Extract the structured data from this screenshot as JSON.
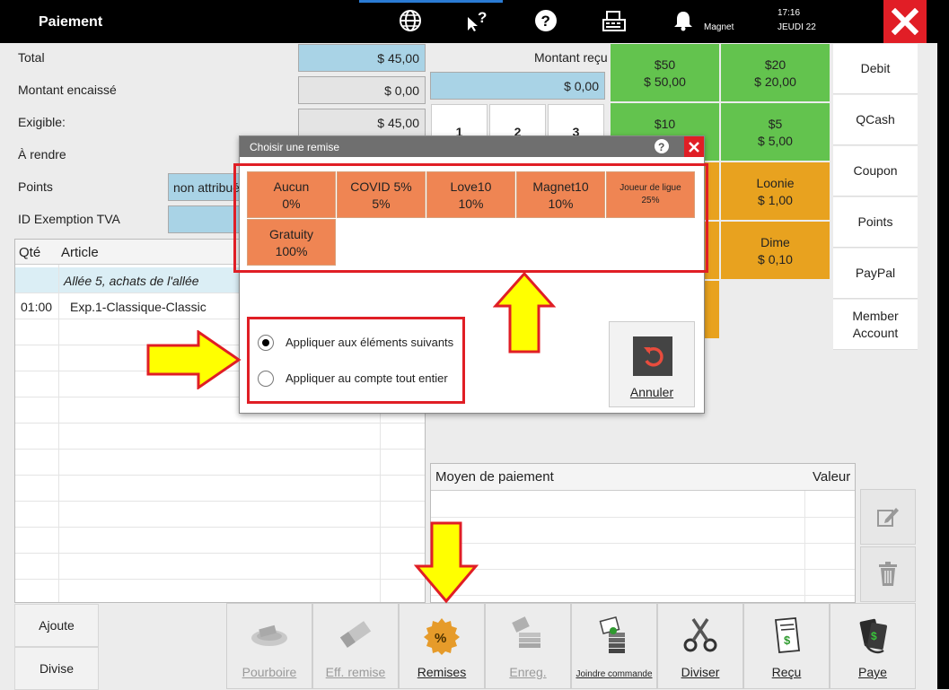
{
  "topbar": {
    "title": "Paiement",
    "user": "Magnet",
    "time": "17:16",
    "day": "JEUDI 22",
    "icons": [
      "globe-icon",
      "help-cursor-icon",
      "help-icon",
      "cash-register-icon",
      "bell-icon",
      "close-icon"
    ]
  },
  "summary": {
    "total_label": "Total",
    "total_value": "$ 45,00",
    "encaisse_label": "Montant encaissé",
    "encaisse_value": "$ 0,00",
    "exigible_label": "Exigible:",
    "exigible_value": "$ 45,00",
    "rendre_label": "À rendre",
    "points_label": "Points",
    "points_value": "non attribué",
    "tva_label": "ID Exemption TVA"
  },
  "items_table": {
    "headers": {
      "qty": "Qté",
      "article": "Article"
    },
    "group": "Allée 5, achats de l'allée",
    "rows": [
      {
        "qty": "01:00",
        "article": "Exp.1-Classique-Classic"
      }
    ]
  },
  "payment": {
    "received_label": "Montant reçu",
    "received_value": "$ 0,00",
    "keypad": [
      "1",
      "2",
      "3"
    ],
    "cash": [
      {
        "label": "$50",
        "value": "$ 50,00",
        "color": "#63c34e"
      },
      {
        "label": "$20",
        "value": "$ 20,00",
        "color": "#63c34e"
      },
      {
        "label": "$10",
        "value": "",
        "color": "#63c34e"
      },
      {
        "label": "$5",
        "value": "$ 5,00",
        "color": "#63c34e"
      },
      {
        "label": "Loonie",
        "value": "$ 1,00",
        "color": "#e8a21f"
      },
      {
        "label": "Dime",
        "value": "$ 0,10",
        "color": "#e8a21f"
      }
    ],
    "methods": [
      "Debit",
      "QCash",
      "Coupon",
      "Points",
      "PayPal",
      "Member Account"
    ],
    "table_headers": {
      "method": "Moyen de paiement",
      "value": "Valeur"
    }
  },
  "left_buttons": {
    "add": "Ajoute",
    "split": "Divise"
  },
  "bottom_buttons": [
    {
      "label": "Pourboire",
      "icon": "tip-plate-icon",
      "enabled": false
    },
    {
      "label": "Eff. remise",
      "icon": "eraser-icon",
      "enabled": false
    },
    {
      "label": "Remises",
      "icon": "discount-badge-icon",
      "enabled": true
    },
    {
      "label": "Enreg.",
      "icon": "save-stack-icon",
      "enabled": false
    },
    {
      "label": "Joindre commande",
      "icon": "join-order-icon",
      "enabled": true
    },
    {
      "label": "Diviser",
      "icon": "scissors-icon",
      "enabled": true
    },
    {
      "label": "Reçu",
      "icon": "receipt-icon",
      "enabled": true
    },
    {
      "label": "Paye",
      "icon": "pay-card-icon",
      "enabled": true
    }
  ],
  "dialog": {
    "title": "Choisir une remise",
    "discounts": [
      {
        "name": "Aucun",
        "pct": "0%"
      },
      {
        "name": "COVID 5%",
        "pct": "5%"
      },
      {
        "name": "Love10",
        "pct": "10%"
      },
      {
        "name": "Magnet10",
        "pct": "10%"
      },
      {
        "name": "Joueur de ligue",
        "pct": "25%"
      },
      {
        "name": "Gratuity",
        "pct": "100%"
      }
    ],
    "option_items": "Appliquer aux éléments suivants",
    "option_account": "Appliquer au compte tout entier",
    "cancel": "Annuler"
  },
  "colors": {
    "accent_red": "#e01e25",
    "discount": "#ef8553",
    "arrow": "#ffff00",
    "cash_green": "#63c34e",
    "coin_orange": "#e8a21f"
  }
}
